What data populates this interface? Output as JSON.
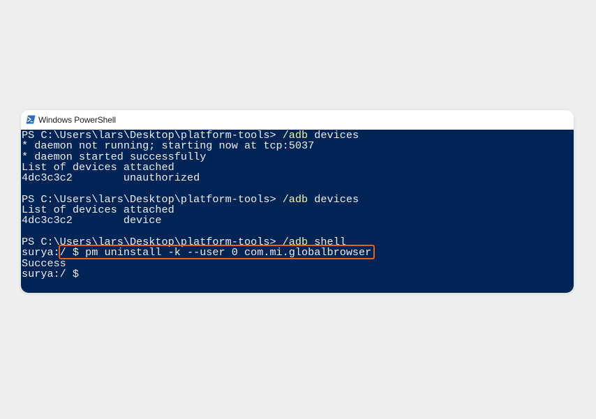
{
  "window": {
    "title": "Windows PowerShell",
    "icon": "powershell-icon",
    "colors": {
      "console_background": "#012456",
      "console_text": "#eeedf0",
      "command_text": "#f9f1a5",
      "highlight_border": "#e9611d"
    }
  },
  "console": {
    "lines": [
      {
        "prompt": "PS C:\\Users\\lars\\Desktop\\platform-tools> ",
        "command": "/adb",
        "rest": " devices"
      },
      {
        "text": "* daemon not running; starting now at tcp:5037"
      },
      {
        "text": "* daemon started successfully"
      },
      {
        "text": "List of devices attached"
      },
      {
        "text": "4dc3c3c2        unauthorized"
      },
      {
        "text": ""
      },
      {
        "prompt": "PS C:\\Users\\lars\\Desktop\\platform-tools> ",
        "command": "/adb",
        "rest": " devices"
      },
      {
        "text": "List of devices attached"
      },
      {
        "text": "4dc3c3c2        device"
      },
      {
        "text": ""
      },
      {
        "prompt": "PS C:\\Users\\lars\\Desktop\\platform-tools> ",
        "command": "/adb",
        "rest": " shell"
      },
      {
        "text": "surya:/ $ pm uninstall -k --user 0 com.mi.globalbrowser"
      },
      {
        "text": "Success"
      },
      {
        "text": "surya:/ $ "
      }
    ]
  }
}
